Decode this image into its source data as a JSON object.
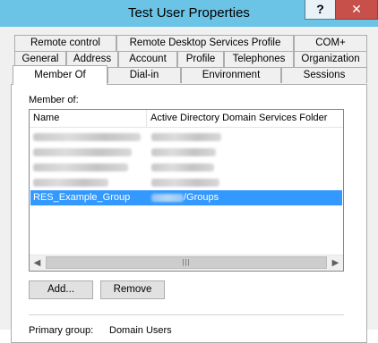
{
  "window": {
    "title": "Test User Properties",
    "help_label": "?",
    "close_label": "✕"
  },
  "tabs": {
    "row1": [
      "Remote control",
      "Remote Desktop Services Profile",
      "COM+"
    ],
    "row2": [
      "General",
      "Address",
      "Account",
      "Profile",
      "Telephones",
      "Organization"
    ],
    "row3": [
      "Member Of",
      "Dial-in",
      "Environment",
      "Sessions"
    ],
    "selected": "Member Of"
  },
  "member_of": {
    "label": "Member of:",
    "columns": [
      "Name",
      "Active Directory Domain Services Folder"
    ],
    "selected_row": {
      "name": "RES_Example_Group",
      "folder": "/Groups"
    }
  },
  "buttons": {
    "add": "Add...",
    "remove": "Remove"
  },
  "primary_group": {
    "label": "Primary group:",
    "value": "Domain Users"
  },
  "colors": {
    "titlebar": "#6bc4e6",
    "selection": "#3399ff"
  }
}
